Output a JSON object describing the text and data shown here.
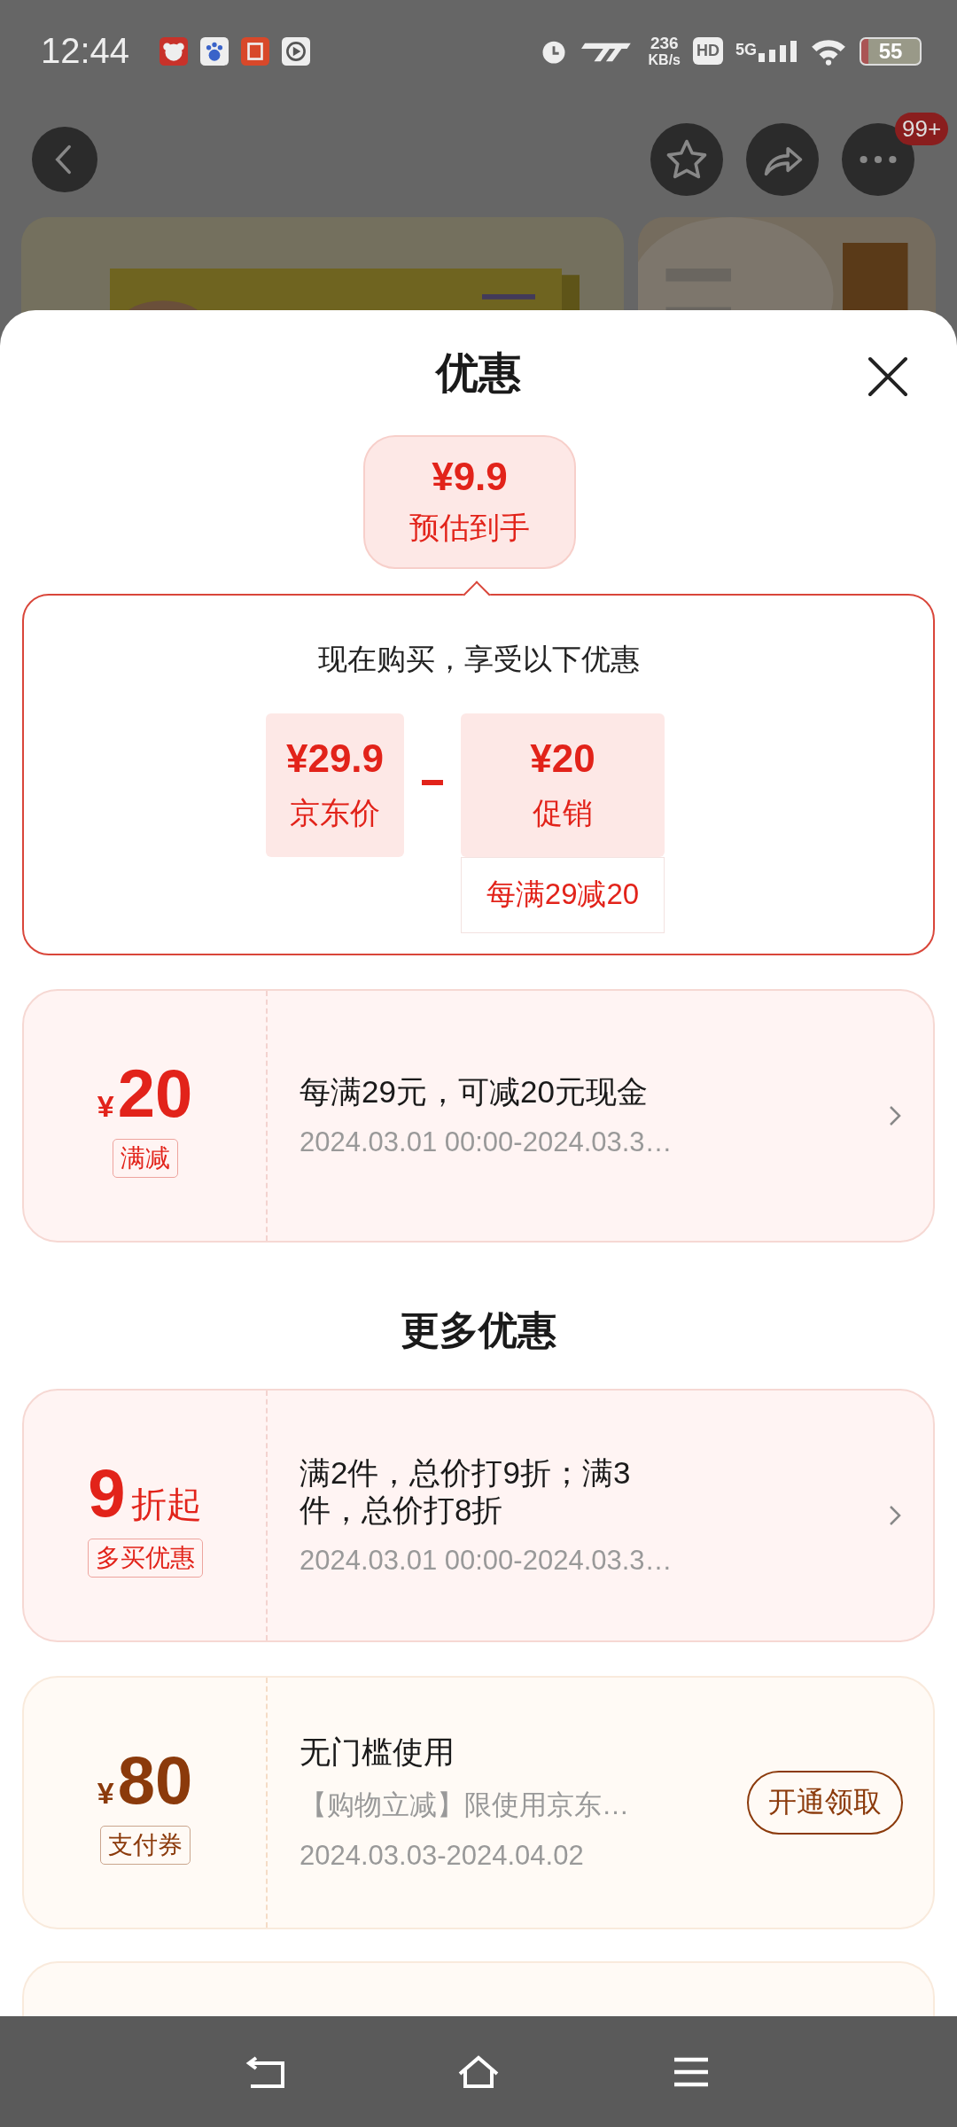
{
  "status_bar": {
    "time": "12:44",
    "net_speed": "236",
    "net_unit": "KB/s",
    "hd": "HD",
    "network": "5G",
    "battery": "55"
  },
  "header": {
    "more_badge": "99+"
  },
  "sheet": {
    "title": "优惠"
  },
  "estimate": {
    "price": "¥9.9",
    "label": "预估到手"
  },
  "breakdown": {
    "heading": "现在购买，享受以下优惠",
    "items": [
      {
        "price": "¥29.9",
        "label": "京东价"
      },
      {
        "price": "¥20",
        "label": "促销",
        "note": "每满29减20"
      }
    ]
  },
  "coupons": [
    {
      "kind": "promo",
      "prefix": "¥",
      "value": "20",
      "tag": "满减",
      "title": "每满29元，可减20元现金",
      "date": "2024.03.01 00:00-2024.03.3…"
    }
  ],
  "more_heading": "更多优惠",
  "more_coupons": [
    {
      "kind": "promo",
      "value": "9",
      "suffix": "折起",
      "tag": "多买优惠",
      "title": "满2件，总价打9折；满3件，总价打8折",
      "date": "2024.03.01 00:00-2024.03.3…"
    },
    {
      "kind": "voucher",
      "prefix": "¥",
      "value": "80",
      "tag": "支付券",
      "title": "无门槛使用",
      "subtitle": "【购物立减】限使用京东…",
      "date": "2024.03.03-2024.04.02",
      "action": "开通领取"
    }
  ]
}
